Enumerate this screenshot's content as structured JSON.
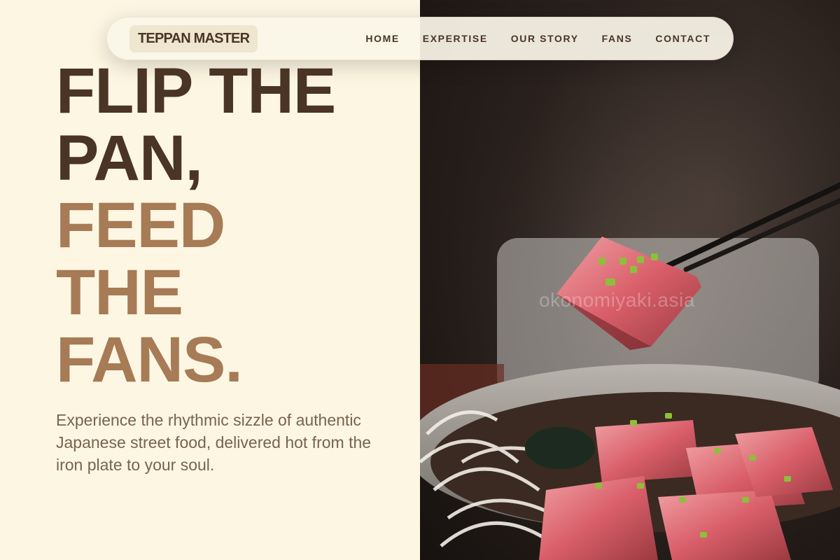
{
  "brand": {
    "logo_text": "TEPPAN MASTER"
  },
  "nav": {
    "items": [
      {
        "label": "HOME"
      },
      {
        "label": "EXPERTISE"
      },
      {
        "label": "OUR STORY"
      },
      {
        "label": "FANS"
      },
      {
        "label": "CONTACT"
      }
    ]
  },
  "hero": {
    "headline_lines": [
      "FLIP THE",
      "PAN,",
      "FEED",
      "THE",
      "FANS."
    ],
    "subtitle": "Experience the rhythmic sizzle of authentic Japanese street food, delivered hot from the iron plate to your soul."
  },
  "photo": {
    "watermark": "okonomiyaki.asia"
  },
  "colors": {
    "background": "#fdf6e3",
    "headline_dark": "#4a3423",
    "headline_accent": "#a67b55",
    "text": "#7a634e"
  }
}
